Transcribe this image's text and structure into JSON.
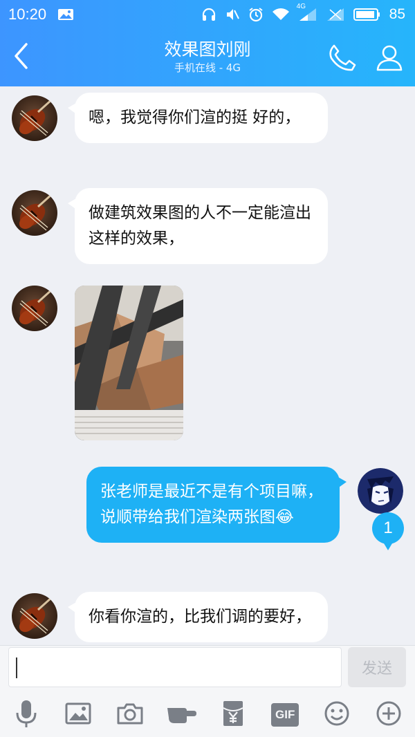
{
  "status_bar": {
    "time": "10:20",
    "network": "4G",
    "battery": "85",
    "icons": [
      "image-icon",
      "headphone-icon",
      "mute-icon",
      "alarm-icon",
      "wifi-icon",
      "signal-icon",
      "signal-icon",
      "battery-icon"
    ]
  },
  "header": {
    "title": "效果图刘刚",
    "subtitle": "手机在线 - 4G",
    "icons": [
      "back-icon",
      "phone-icon",
      "profile-icon"
    ]
  },
  "messages": [
    {
      "sender": "contact",
      "type": "text",
      "text": "嗯，我觉得你们渲的挺 好的，"
    },
    {
      "sender": "contact",
      "type": "text",
      "text": "做建筑效果图的人不一定能渲出这样的效果，"
    },
    {
      "sender": "contact",
      "type": "image"
    },
    {
      "sender": "me",
      "type": "text",
      "text": "张老师是最近不是有个项目嘛，说顺带给我们渲染两张图",
      "emoji": "😂"
    },
    {
      "sender": "contact",
      "type": "text",
      "text": "你看你渲的，比我们调的要好，"
    }
  ],
  "unread_count": "1",
  "composer": {
    "input_value": "",
    "send_label": "发送",
    "gif_label": "GIF",
    "tools": [
      "mic-icon",
      "picture-icon",
      "camera-icon",
      "poke-icon",
      "red-packet-icon",
      "gif-icon",
      "emoji-icon",
      "plus-icon"
    ]
  },
  "colors": {
    "header_start": "#3d95ff",
    "header_end": "#26b5fb",
    "outgoing_bubble": "#1eb1f5",
    "incoming_bubble": "#ffffff",
    "background": "#eef0f5"
  }
}
